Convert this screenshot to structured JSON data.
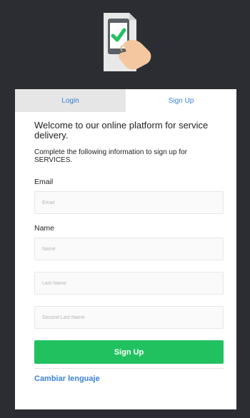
{
  "logo": {
    "icon": "tablet-checkmark-hand-icon",
    "colors": {
      "frame": "#e8e8e8",
      "screen": "#5b5f66",
      "check": "#22c160",
      "hand": "#f4c7a0"
    }
  },
  "tabs": [
    {
      "label": "Login",
      "active": false
    },
    {
      "label": "Sign Up",
      "active": true
    }
  ],
  "form": {
    "welcome": "Welcome to our online platform for service delivery.",
    "instructions": "Complete the following information to sign up for SERVICES.",
    "email_label": "Email",
    "email_placeholder": "Email",
    "name_label": "Name",
    "name_placeholder": "Name",
    "last_name_placeholder": "Last Name",
    "second_last_name_placeholder": "Second Last Name",
    "submit_label": "Sign Up",
    "language_link": "Cambiar lenguaje"
  },
  "colors": {
    "background": "#2b2d33",
    "accent": "#3b82d6",
    "primary_button": "#22c160",
    "inactive_tab": "#e6e6e6"
  }
}
